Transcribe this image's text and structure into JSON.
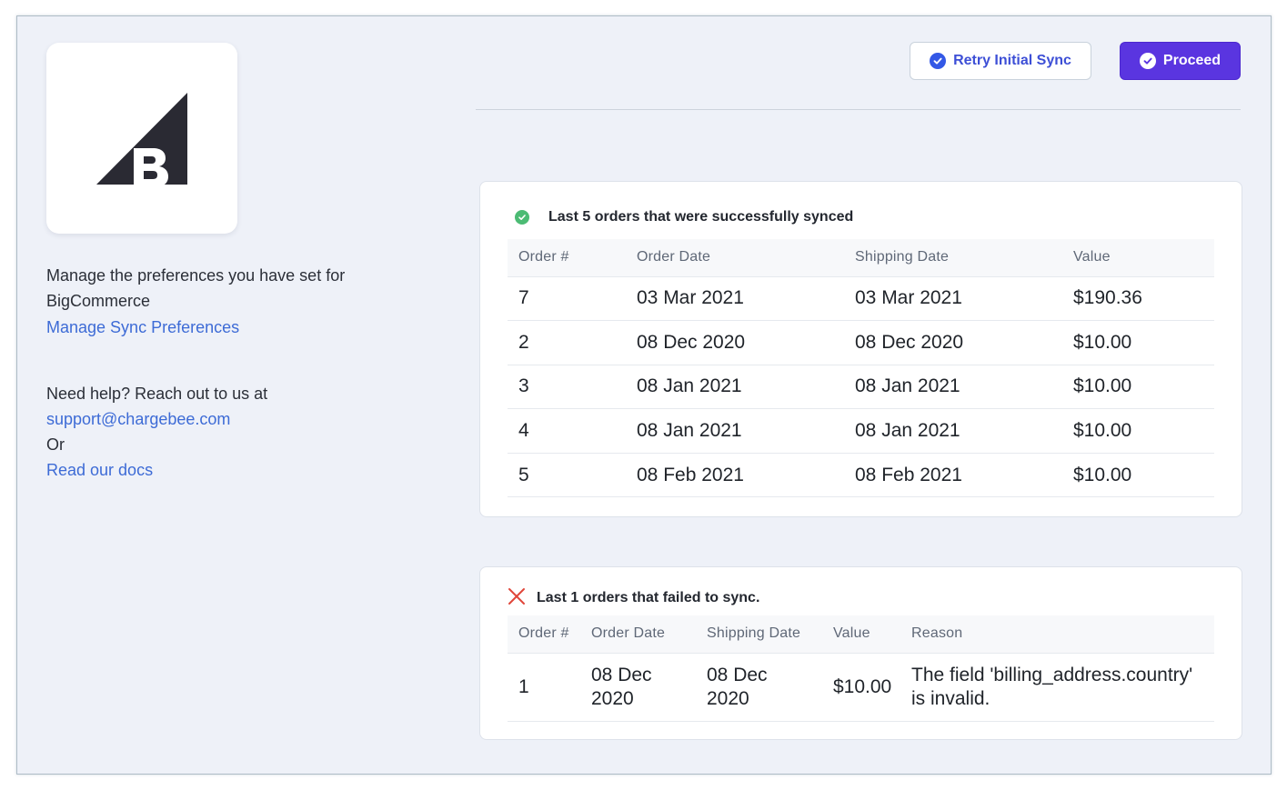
{
  "header": {
    "retry_label": "Retry Initial Sync",
    "proceed_label": "Proceed"
  },
  "sidebar": {
    "logo_icon": "bigcommerce-logo",
    "prefs_text": "Manage the preferences you have set for BigCommerce",
    "prefs_link": "Manage Sync Preferences",
    "help_text": "Need help? Reach out to us at",
    "help_email": "support@chargebee.com",
    "help_or": "Or",
    "help_docs": "Read our docs"
  },
  "success": {
    "title": "Last 5 orders that were successfully synced",
    "icon": "check-circle-icon",
    "columns": [
      "Order #",
      "Order Date",
      "Shipping Date",
      "Value"
    ],
    "rows": [
      [
        "7",
        "03 Mar 2021",
        "03 Mar 2021",
        "$190.36"
      ],
      [
        "2",
        "08 Dec 2020",
        "08 Dec 2020",
        "$10.00"
      ],
      [
        "3",
        "08 Jan 2021",
        "08 Jan 2021",
        "$10.00"
      ],
      [
        "4",
        "08 Jan 2021",
        "08 Jan 2021",
        "$10.00"
      ],
      [
        "5",
        "08 Feb 2021",
        "08 Feb 2021",
        "$10.00"
      ]
    ]
  },
  "failed": {
    "title": "Last 1 orders that failed to sync.",
    "icon": "x-icon",
    "columns": [
      "Order #",
      "Order Date",
      "Shipping Date",
      "Value",
      "Reason"
    ],
    "rows": [
      [
        "1",
        "08 Dec 2020",
        "08 Dec 2020",
        "$10.00",
        "The field 'billing_address.country' is invalid."
      ]
    ]
  },
  "colors": {
    "accent": "#5a35e0",
    "link": "#3d6bd6",
    "success": "#4cbb74",
    "error": "#e0463a"
  }
}
